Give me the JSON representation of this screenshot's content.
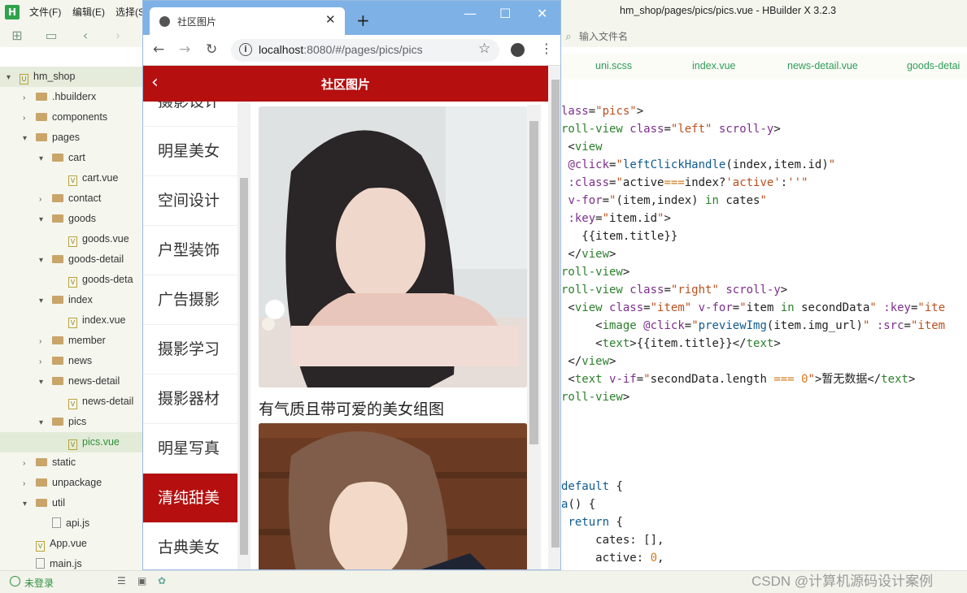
{
  "ide": {
    "logo": "H",
    "menu": [
      "文件(F)",
      "编辑(E)",
      "选择(S"
    ],
    "window_title": "hm_shop/pages/pics/pics.vue - HBuilder X 3.2.3",
    "file_search_placeholder": "输入文件名",
    "tree": [
      {
        "label": "hm_shop",
        "type": "project",
        "expanded": true
      },
      {
        "label": ".hbuilderx",
        "type": "folder"
      },
      {
        "label": "components",
        "type": "folder"
      },
      {
        "label": "pages",
        "type": "folder",
        "expanded": true
      },
      {
        "label": "cart",
        "type": "folder",
        "expanded": true
      },
      {
        "label": "cart.vue",
        "type": "vue"
      },
      {
        "label": "contact",
        "type": "folder"
      },
      {
        "label": "goods",
        "type": "folder",
        "expanded": true
      },
      {
        "label": "goods.vue",
        "type": "vue"
      },
      {
        "label": "goods-detail",
        "type": "folder",
        "expanded": true
      },
      {
        "label": "goods-deta",
        "type": "vue"
      },
      {
        "label": "index",
        "type": "folder",
        "expanded": true
      },
      {
        "label": "index.vue",
        "type": "vue"
      },
      {
        "label": "member",
        "type": "folder"
      },
      {
        "label": "news",
        "type": "folder"
      },
      {
        "label": "news-detail",
        "type": "folder",
        "expanded": true
      },
      {
        "label": "news-detail",
        "type": "vue"
      },
      {
        "label": "pics",
        "type": "folder",
        "expanded": true
      },
      {
        "label": "pics.vue",
        "type": "vue",
        "selected": true
      },
      {
        "label": "static",
        "type": "folder"
      },
      {
        "label": "unpackage",
        "type": "folder"
      },
      {
        "label": "util",
        "type": "folder",
        "expanded": true
      },
      {
        "label": "api.js",
        "type": "js"
      },
      {
        "label": "App.vue",
        "type": "vue"
      },
      {
        "label": "main.js",
        "type": "js"
      }
    ],
    "editor_tabs": [
      "uni.scss",
      "index.vue",
      "news-detail.vue",
      "goods-detai"
    ],
    "status_login": "未登录",
    "watermark": "CSDN @计算机源码设计案例"
  },
  "browser": {
    "tab_title": "社区图片",
    "url_host": "localhost",
    "url_rest": ":8080/#/pages/pics/pics",
    "app": {
      "title": "社区图片",
      "categories": [
        "摄影设计",
        "明星美女",
        "空间设计",
        "户型装饰",
        "广告摄影",
        "摄影学习",
        "摄影器材",
        "明星写真",
        "清纯甜美",
        "古典美女"
      ],
      "active_index": 8,
      "items": [
        {
          "caption": "有气质且带可爱的美女组图"
        }
      ]
    }
  }
}
